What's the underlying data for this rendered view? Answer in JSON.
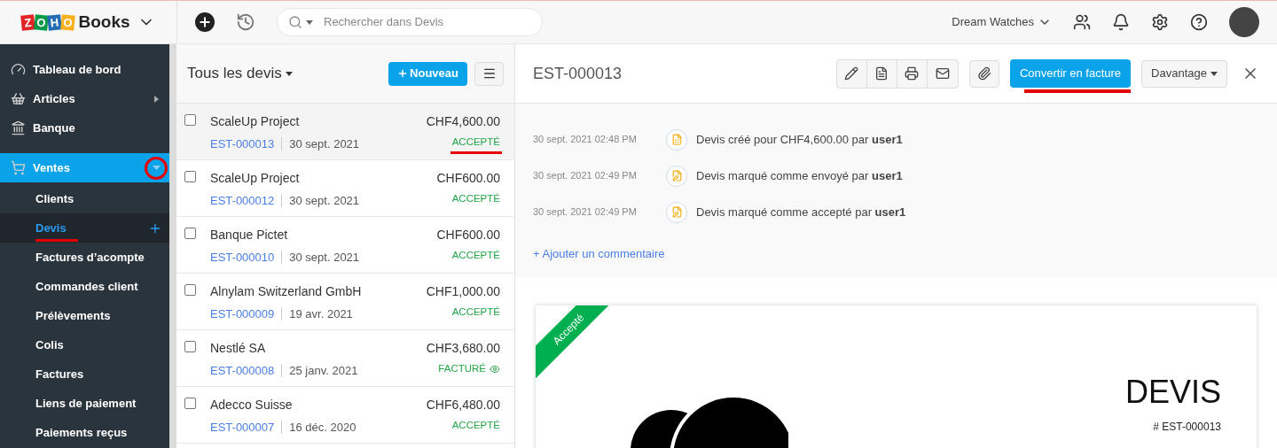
{
  "logo": {
    "letters": [
      {
        "char": "Z",
        "color": "#e42527"
      },
      {
        "char": "O",
        "color": "#089949"
      },
      {
        "char": "H",
        "color": "#226db4"
      },
      {
        "char": "O",
        "color": "#f9b21d"
      }
    ],
    "word": "Books"
  },
  "topbar": {
    "search_placeholder": "Rechercher dans Devis",
    "organization": "Dream Watches"
  },
  "sidebar": {
    "items": [
      {
        "label": "Tableau de bord",
        "selected": false,
        "has_arrow": false
      },
      {
        "label": "Articles",
        "selected": false,
        "has_arrow": true
      },
      {
        "label": "Banque",
        "selected": false,
        "has_arrow": false
      },
      {
        "label": "Ventes",
        "selected": true,
        "has_arrow": false,
        "expanded": true,
        "children": [
          {
            "label": "Clients",
            "selected": false
          },
          {
            "label": "Devis",
            "selected": true
          },
          {
            "label": "Factures d’acompte",
            "selected": false
          },
          {
            "label": "Commandes client",
            "selected": false
          },
          {
            "label": "Prélèvements",
            "selected": false
          },
          {
            "label": "Colis",
            "selected": false
          },
          {
            "label": "Factures",
            "selected": false
          },
          {
            "label": "Liens de paiement",
            "selected": false
          },
          {
            "label": "Paiements reçus",
            "selected": false
          }
        ]
      }
    ]
  },
  "list": {
    "title": "Tous les devis",
    "new_button": "Nouveau",
    "rows": [
      {
        "name": "ScaleUp Project",
        "number": "EST-000013",
        "date": "30 sept. 2021",
        "amount": "CHF4,600.00",
        "status": "ACCEPTÉ",
        "kind": "accepted",
        "selected": true,
        "checked": false
      },
      {
        "name": "ScaleUp Project",
        "number": "EST-000012",
        "date": "30 sept. 2021",
        "amount": "CHF600.00",
        "status": "ACCEPTÉ",
        "kind": "accepted",
        "selected": false,
        "checked": false
      },
      {
        "name": "Banque Pictet",
        "number": "EST-000010",
        "date": "30 sept. 2021",
        "amount": "CHF600.00",
        "status": "ACCEPTÉ",
        "kind": "accepted",
        "selected": false,
        "checked": false
      },
      {
        "name": "Alnylam Switzerland GmbH",
        "number": "EST-000009",
        "date": "19 avr. 2021",
        "amount": "CHF1,000.00",
        "status": "ACCEPTÉ",
        "kind": "accepted",
        "selected": false,
        "checked": false
      },
      {
        "name": "Nestlé SA",
        "number": "EST-000008",
        "date": "25 janv. 2021",
        "amount": "CHF3,680.00",
        "status": "FACTURÉ",
        "kind": "invoiced",
        "selected": false,
        "checked": false
      },
      {
        "name": "Adecco Suisse",
        "number": "EST-000007",
        "date": "16 déc. 2020",
        "amount": "CHF6,480.00",
        "status": "ACCEPTÉ",
        "kind": "accepted",
        "selected": false,
        "checked": false
      }
    ]
  },
  "detail": {
    "title": "EST-000013",
    "convert_button": "Convertir en facture",
    "more_button": "Davantage",
    "history": [
      {
        "time": "30 sept. 2021 02:48 PM",
        "text": "Devis créé pour CHF4,600.00 par **user1**",
        "kind": "created"
      },
      {
        "time": "30 sept. 2021 02:49 PM",
        "text": "Devis marqué comme envoyé par **user1**",
        "kind": "edited"
      },
      {
        "time": "30 sept. 2021 02:49 PM",
        "text": "Devis marqué comme accepté par **user1**",
        "kind": "edited"
      }
    ],
    "add_comment": "+ Ajouter un commentaire",
    "document": {
      "ribbon": "Accepté",
      "heading": "DEVIS",
      "number": "# EST-000013"
    }
  }
}
